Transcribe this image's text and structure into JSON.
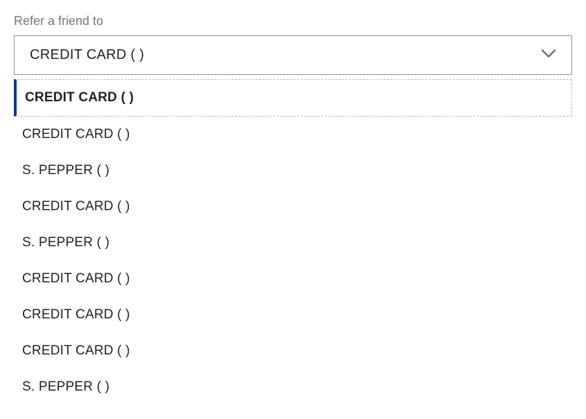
{
  "field": {
    "label": "Refer a friend to",
    "selected_value": "CREDIT CARD (           )"
  },
  "dropdown": {
    "options": [
      {
        "label": "CREDIT CARD (          )",
        "selected": true
      },
      {
        "label": "CREDIT CARD (           )",
        "selected": false
      },
      {
        "label": "S. PEPPER (          )",
        "selected": false
      },
      {
        "label": "CREDIT CARD  (           )",
        "selected": false
      },
      {
        "label": "S. PEPPER  (          )",
        "selected": false
      },
      {
        "label": "CREDIT CARD  (           )",
        "selected": false
      },
      {
        "label": "CREDIT CARD  (           )",
        "selected": false
      },
      {
        "label": "CREDIT CARD  (           )",
        "selected": false
      },
      {
        "label": "S. PEPPER (           )",
        "selected": false
      }
    ]
  }
}
